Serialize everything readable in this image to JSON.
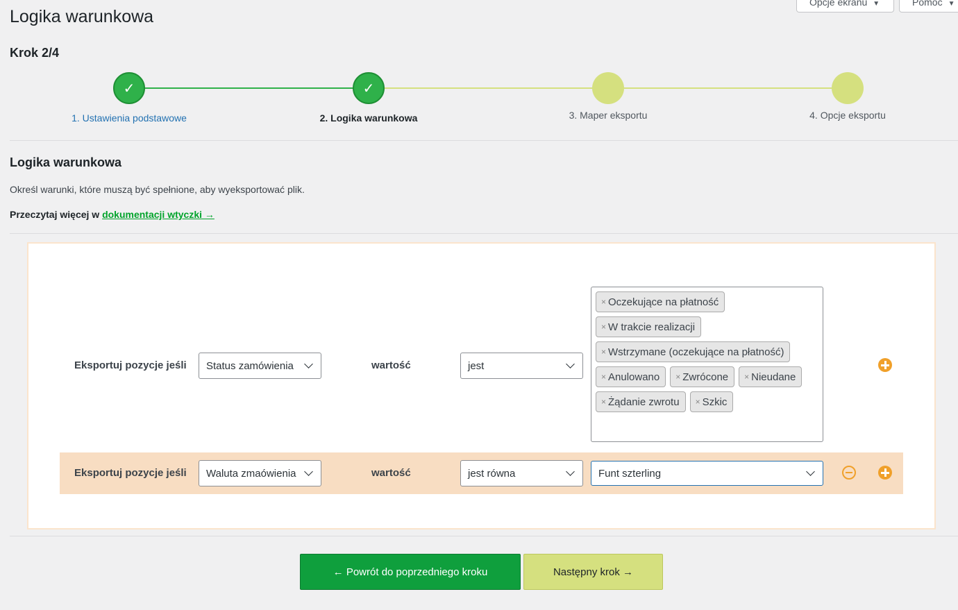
{
  "header": {
    "title": "Logika warunkowa",
    "screen_options": "Opcje ekranu",
    "help": "Pomoc",
    "step_counter": "Krok 2/4"
  },
  "steps": [
    {
      "label": "1. Ustawienia podstawowe",
      "state": "done"
    },
    {
      "label": "2. Logika warunkowa",
      "state": "active"
    },
    {
      "label": "3. Maper eksportu",
      "state": "todo"
    },
    {
      "label": "4. Opcje eksportu",
      "state": "todo"
    }
  ],
  "section": {
    "title": "Logika warunkowa",
    "description": "Określ warunki, które muszą być spełnione, aby wyeksportować plik.",
    "docs_prefix": "Przeczytaj więcej w",
    "docs_link": "dokumentacji wtyczki →"
  },
  "rules": [
    {
      "label": "Eksportuj pozycje jeśli",
      "field": "Status zamówienia",
      "value_label": "wartość",
      "operator": "jest",
      "values": [
        "Oczekujące na płatność",
        "W trakcie realizacji",
        "Wstrzymane (oczekujące na płatność)",
        "Anulowano",
        "Zwrócone",
        "Nieudane",
        "Żądanie zwrotu",
        "Szkic"
      ]
    },
    {
      "label": "Eksportuj pozycje jeśli",
      "field": "Waluta zmaówienia",
      "value_label": "wartość",
      "operator": "jest równa",
      "value": "Funt szterling"
    }
  ],
  "footer": {
    "back": "← Powrót do poprzedniego kroku",
    "next": "Następny krok →"
  },
  "colors": {
    "done": "#2fb14a",
    "todo": "#d5e07f",
    "accent": "#f0a02a",
    "highlight_row": "#f8ddc2"
  }
}
